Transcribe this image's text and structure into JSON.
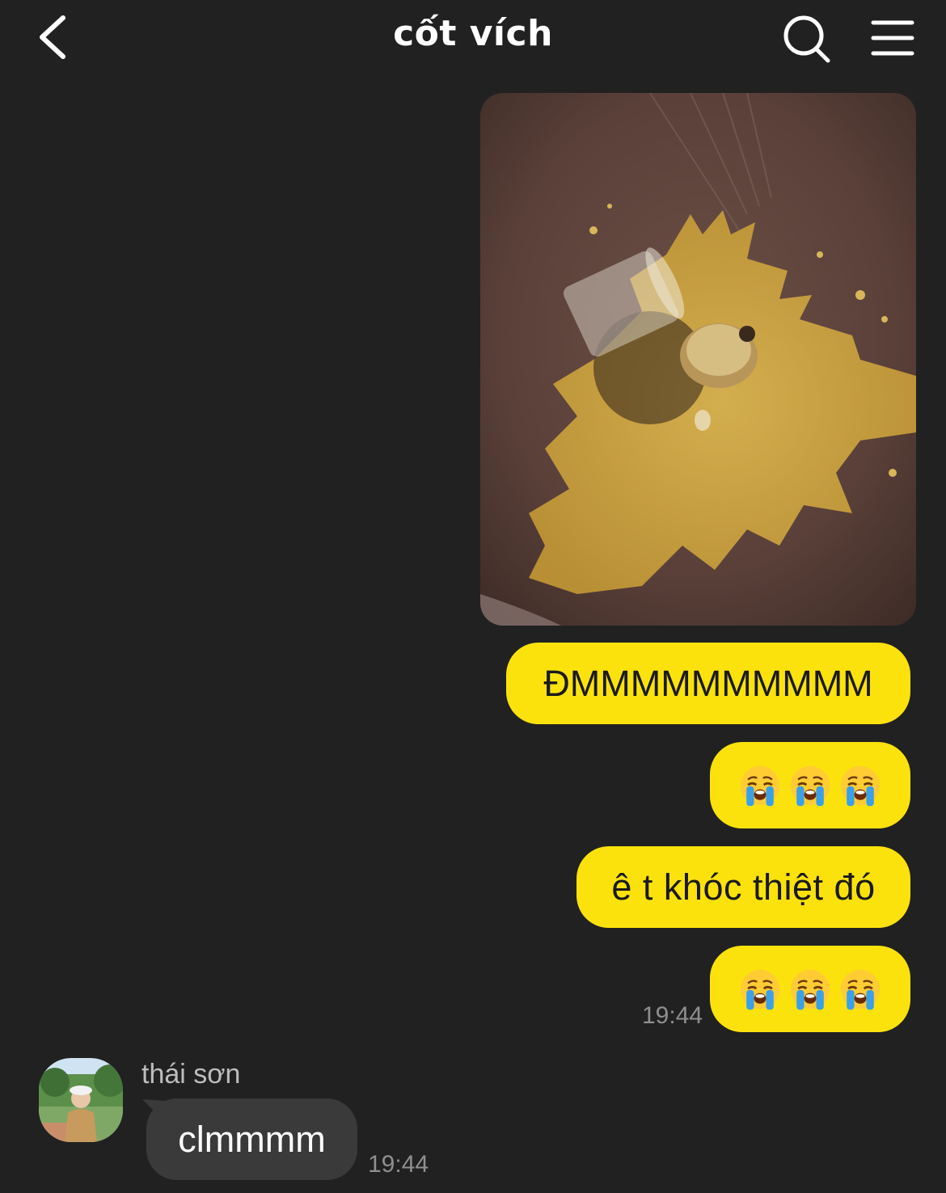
{
  "header": {
    "title": "cốt vích",
    "icons": {
      "back": "chevron-left-icon",
      "search": "search-icon",
      "menu": "hamburger-menu-icon"
    }
  },
  "messages": {
    "outgoing": [
      {
        "type": "image",
        "description_icon": "photo-spilled-coffee"
      },
      {
        "type": "text",
        "text": "ĐMMMMMMMMMM"
      },
      {
        "type": "emoji",
        "emoji": [
          "😭",
          "😭",
          "😭"
        ]
      },
      {
        "type": "text",
        "text": "ê t khóc thiệt đó"
      },
      {
        "type": "emoji",
        "emoji": [
          "😭",
          "😭",
          "😭"
        ]
      }
    ],
    "outgoing_time": "19:44",
    "incoming": {
      "sender": "thái sơn",
      "text": "clmmmm",
      "time": "19:44"
    }
  },
  "colors": {
    "background": "#212121",
    "outgoing_bubble": "#fbe20d",
    "incoming_bubble": "#3a3a3a",
    "timestamp": "#8f8f8f"
  }
}
